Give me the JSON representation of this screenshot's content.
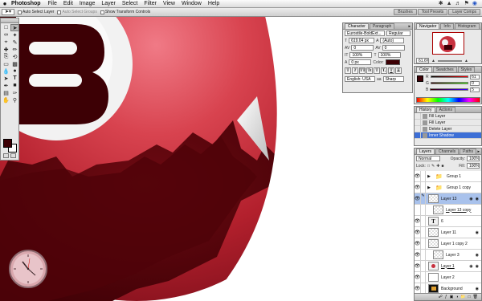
{
  "menubar": {
    "apple": "",
    "app": "Photoshop",
    "menus": [
      "File",
      "Edit",
      "Image",
      "Layer",
      "Select",
      "Filter",
      "View",
      "Window",
      "Help"
    ]
  },
  "options": {
    "auto_select_layer": "Auto Select Layer",
    "auto_select_groups": "Auto Select Groups",
    "show_transform_controls": "Show Transform Controls",
    "wells": [
      "Brushes",
      "Tool Presets",
      "Layer Comps"
    ]
  },
  "character": {
    "tabs": [
      "Character",
      "Paragraph"
    ],
    "font_family": "Eurostile-BoldExt...",
    "font_style": "Regular",
    "font_size": "619.04 px",
    "leading": "(Auto)",
    "kerning": "0",
    "tracking": "0",
    "vscale": "100%",
    "hscale": "100%",
    "baseline": "0 px",
    "color_label": "Color:",
    "language": "English: USA",
    "antialias": "Sharp",
    "style_buttons": [
      "T",
      "T",
      "TT",
      "Tt",
      "T",
      "T,",
      "T",
      "T"
    ]
  },
  "navigator": {
    "tabs": [
      "Navigator",
      "Info",
      "Histogram"
    ],
    "zoom": "61.6%"
  },
  "color": {
    "tabs": [
      "Color",
      "Swatches",
      "Styles"
    ],
    "r": "61",
    "g": "0",
    "b": "5",
    "fg_hex": "#3d0005"
  },
  "history": {
    "tabs": [
      "History",
      "Actions"
    ],
    "items": [
      "Fill Layer",
      "Fill Layer",
      "Delete Layer",
      "Inner Shadow"
    ]
  },
  "layers": {
    "tabs": [
      "Layers",
      "Channels",
      "Paths"
    ],
    "blend_mode": "Normal",
    "opacity_label": "Opacity:",
    "opacity": "100%",
    "lock_label": "Lock:",
    "fill_label": "Fill:",
    "fill": "100%",
    "items": [
      {
        "name": "Group 1",
        "kind": "group",
        "selected": false
      },
      {
        "name": "Group 1 copy",
        "kind": "group",
        "selected": false
      },
      {
        "name": "Layer 13",
        "kind": "layer",
        "selected": true
      },
      {
        "name": "Layer 13 copy",
        "kind": "layer",
        "selected": false
      },
      {
        "name": "6",
        "kind": "text",
        "selected": false
      },
      {
        "name": "Layer 11",
        "kind": "layer",
        "selected": false
      },
      {
        "name": "Layer 1 copy 2",
        "kind": "layer",
        "selected": false
      },
      {
        "name": "Layer 3",
        "kind": "layer",
        "selected": false
      },
      {
        "name": "Layer 1",
        "kind": "layer",
        "selected": false
      },
      {
        "name": "Layer 2",
        "kind": "layer",
        "selected": false
      },
      {
        "name": "Background",
        "kind": "layer",
        "selected": false
      }
    ]
  },
  "canvas": {
    "letter": "B"
  },
  "colors": {
    "dark_red": "#3d0005",
    "ball_red": "#c8323f",
    "selection_blue": "#a9c2ec"
  }
}
